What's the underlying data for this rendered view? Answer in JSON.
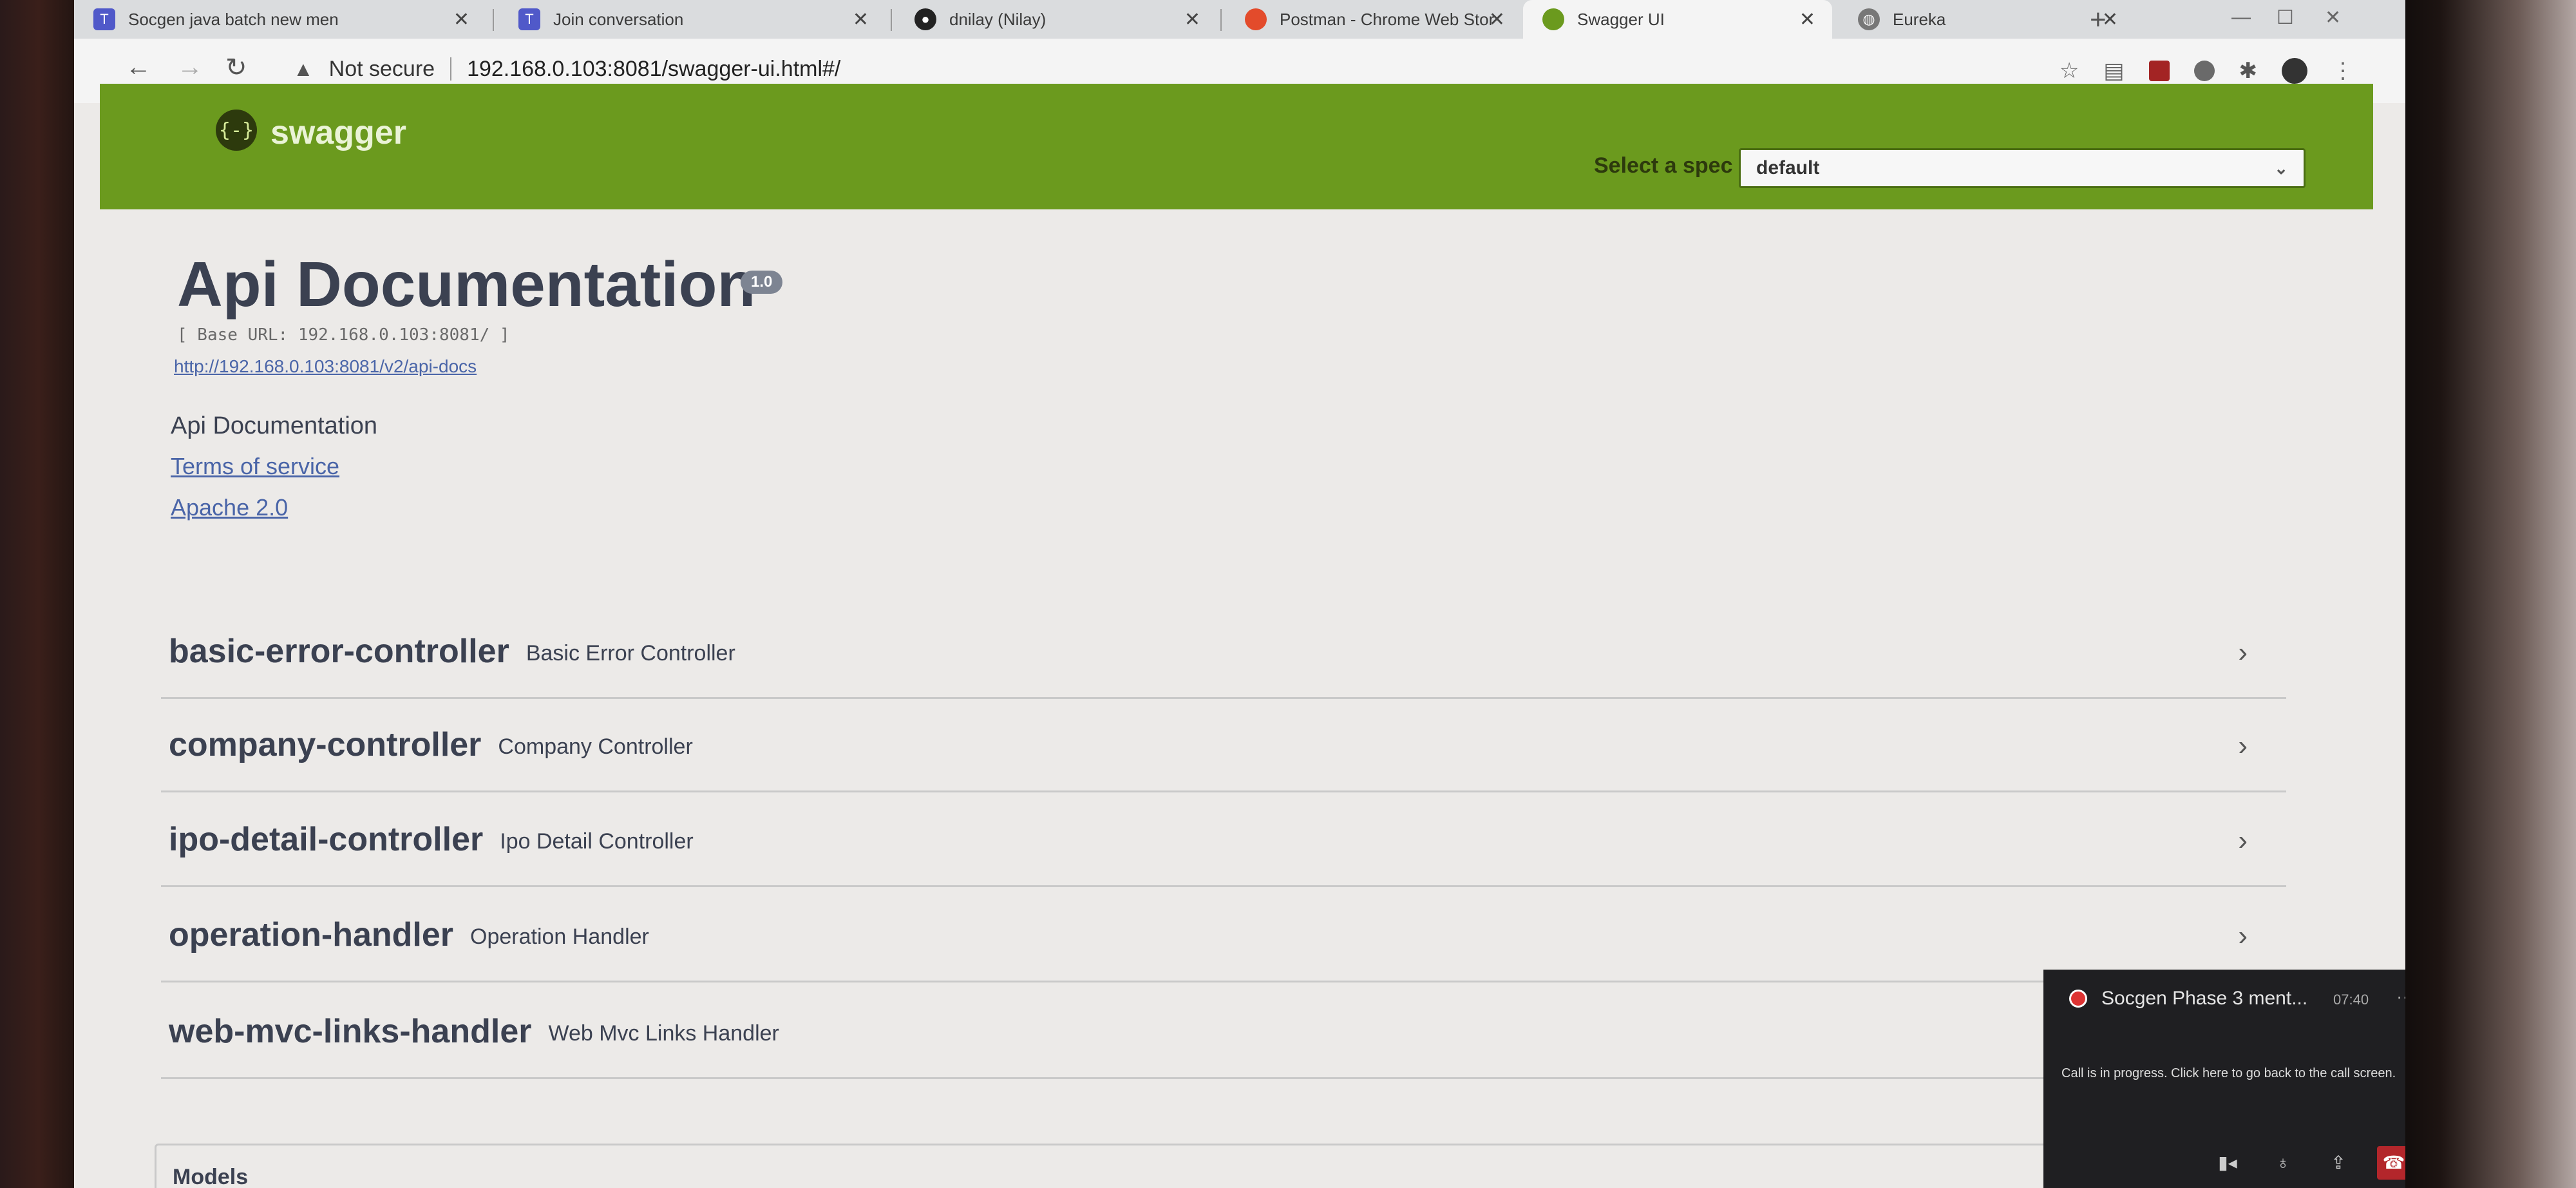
{
  "browser": {
    "tabs": [
      {
        "label": "Socgen java batch new men",
        "close": "✕",
        "icon": "teams-icon"
      },
      {
        "label": "Join conversation",
        "close": "✕",
        "icon": "teams-icon"
      },
      {
        "label": "dnilay (Nilay)",
        "close": "✕",
        "icon": "github-icon"
      },
      {
        "label": "Postman - Chrome Web Stor",
        "close": "✕",
        "icon": "chrome-webstore-icon"
      },
      {
        "label": "Swagger UI",
        "close": "✕",
        "icon": "swagger-icon",
        "active": true
      },
      {
        "label": "Eureka",
        "close": "✕",
        "icon": "globe-icon"
      }
    ],
    "new_tab": "+",
    "address": {
      "security": "Not secure",
      "url": "192.168.0.103:8081/swagger-ui.html#/"
    }
  },
  "swagger": {
    "logo_symbol": "{-}",
    "logo_text": "swagger",
    "spec_label": "Select a spec",
    "spec_value": "default",
    "accent": "#6b9a1e"
  },
  "info": {
    "title": "Api Documentation",
    "version": "1.0",
    "base_url": "[ Base URL: 192.168.0.103:8081/ ]",
    "api_docs_link": "http://192.168.0.103:8081/v2/api-docs",
    "description": "Api Documentation",
    "terms": "Terms of service",
    "license": "Apache 2.0"
  },
  "controllers": [
    {
      "name": "basic-error-controller",
      "description": "Basic Error Controller"
    },
    {
      "name": "company-controller",
      "description": "Company Controller"
    },
    {
      "name": "ipo-detail-controller",
      "description": "Ipo Detail Controller"
    },
    {
      "name": "operation-handler",
      "description": "Operation Handler"
    },
    {
      "name": "web-mvc-links-handler",
      "description": "Web Mvc Links Handler"
    }
  ],
  "models_label": "Models",
  "call": {
    "title": "Socgen Phase 3 ment...",
    "time": "07:40",
    "more": "···",
    "message": "Call is in progress. Click here to go back to the call screen."
  }
}
